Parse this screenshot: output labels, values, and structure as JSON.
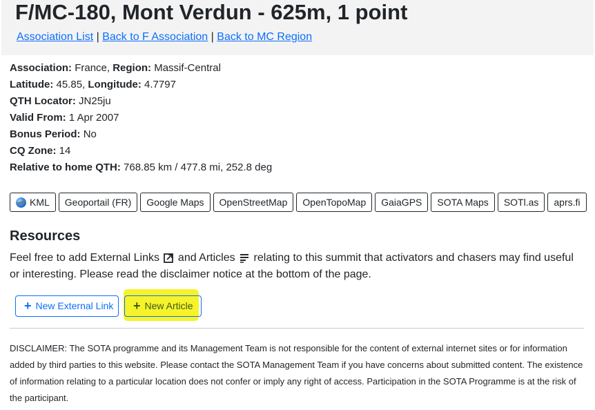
{
  "header": {
    "title": "F/MC-180, Mont Verdun - 625m, 1 point",
    "links": [
      {
        "label": "Association List"
      },
      {
        "label": "Back to F Association"
      },
      {
        "label": "Back to MC Region"
      }
    ],
    "separator": "|"
  },
  "info": {
    "association_label": "Association:",
    "association_value": "France",
    "region_label": "Region:",
    "region_value": "Massif-Central",
    "latitude_label": "Latitude:",
    "latitude_value": "45.85",
    "longitude_label": "Longitude:",
    "longitude_value": "4.7797",
    "qth_label": "QTH Locator:",
    "qth_value": "JN25ju",
    "valid_label": "Valid From:",
    "valid_value": "1 Apr 2007",
    "bonus_label": "Bonus Period:",
    "bonus_value": "No",
    "cq_label": "CQ Zone:",
    "cq_value": "14",
    "relative_label": "Relative to home QTH:",
    "relative_value": "768.85 km / 477.8 mi, 252.8 deg"
  },
  "map_buttons": [
    {
      "label": "KML",
      "icon": "globe-icon"
    },
    {
      "label": "Geoportail (FR)"
    },
    {
      "label": "Google Maps"
    },
    {
      "label": "OpenStreetMap"
    },
    {
      "label": "OpenTopoMap"
    },
    {
      "label": "GaiaGPS"
    },
    {
      "label": "SOTA Maps"
    },
    {
      "label": "SOTl.as"
    },
    {
      "label": "aprs.fi"
    }
  ],
  "resources": {
    "title": "Resources",
    "text_1": "Feel free to add External Links",
    "text_2": "and Articles",
    "text_3": "relating to this summit that activators and chasers may find useful or interesting. Please read the disclaimer notice at the bottom of the page.",
    "new_link_label": "New External Link",
    "new_article_label": "New Article",
    "plus": "+"
  },
  "disclaimer": "DISCLAIMER: The SOTA programme and its Management Team is not responsible for the content of external internet sites or for information added by third parties to this website. Please contact the SOTA Management Team if you have concerns about submitted content. The existence of information relating to a particular location does not confer or imply any right of access. Participation in the SOTA Programme is at the risk of the participant.",
  "colors": {
    "link": "#0d6efd",
    "header_bg": "#f3f3f3",
    "highlight": "#f5f21f"
  }
}
